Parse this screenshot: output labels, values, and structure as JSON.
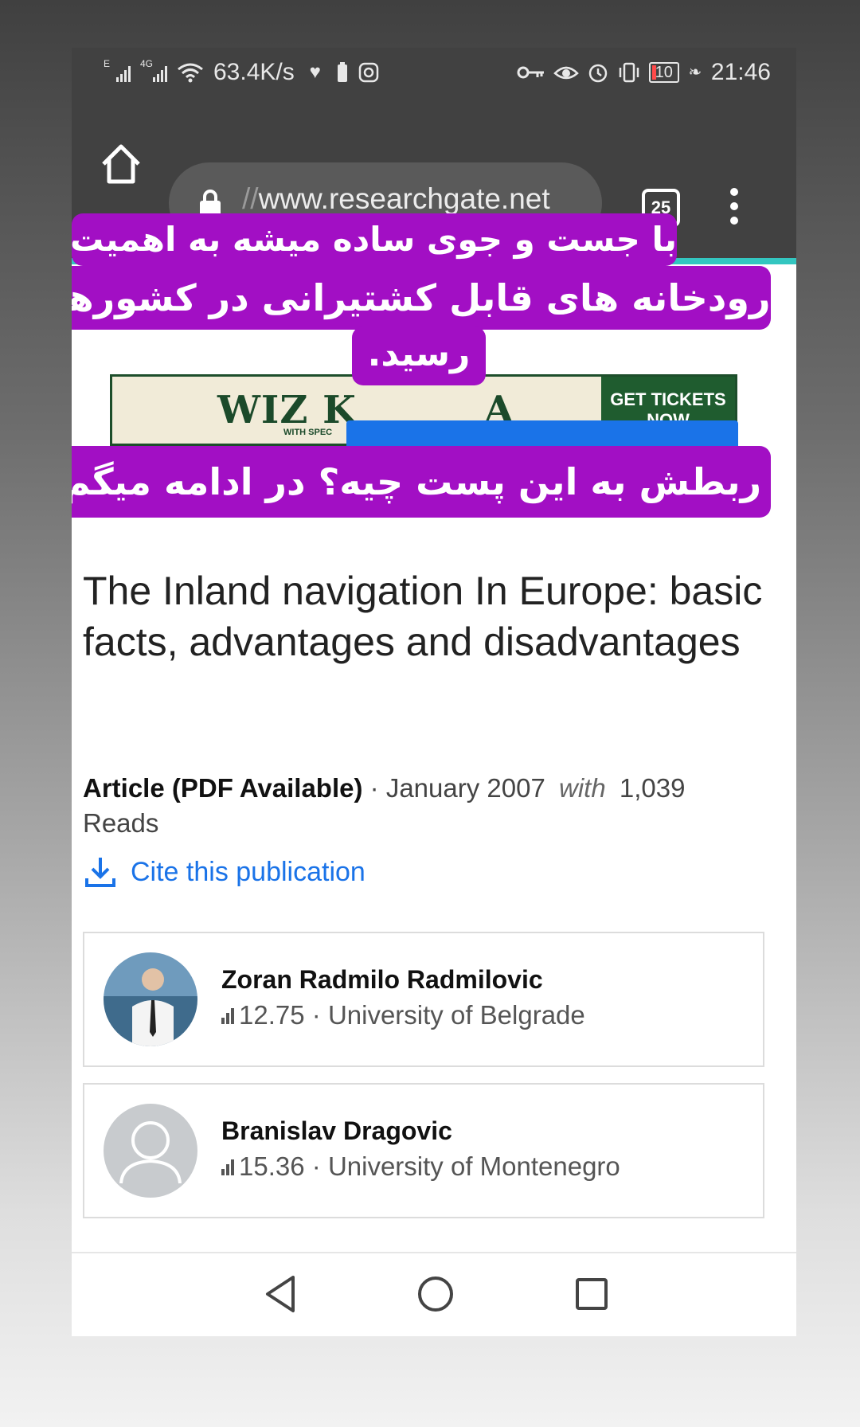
{
  "status_bar": {
    "signal1_label": "E",
    "signal2_label": "4G",
    "network_speed": "63.4K/s",
    "battery_level": "10",
    "time": "21:46",
    "icons": [
      "wifi-icon",
      "heart-icon",
      "battery-saver-icon",
      "instagram-icon",
      "key-icon",
      "eye-icon",
      "alarm-icon",
      "vibrate-icon",
      "leaf-icon"
    ]
  },
  "browser": {
    "url_prefix": "//",
    "url_domain": "www.researchgate.net",
    "tab_count": "25"
  },
  "overlay": {
    "line1": "با جست و جوی ساده میشه به اهمیت",
    "line2": "رودخانه های قابل کشتیرانی در کشورها",
    "line3": "رسید.",
    "line4": "ربطش به این پست چیه؟ در ادامه میگم",
    "color": "#a20fc4"
  },
  "ad": {
    "headline_visible": "WIZ K",
    "headline_tail": "A",
    "sub_visible": "WITH SPEC",
    "cta_line1": "GET TICKETS",
    "cta_line2": "NOW"
  },
  "article": {
    "title": "The Inland navigation In Europe: basic facts, advantages and disadvantages",
    "type": "Article (PDF Available)",
    "separator": "·",
    "date": "January 2007",
    "with_label": "with",
    "reads": "1,039",
    "reads_label": "Reads",
    "cite_label": "Cite this publication"
  },
  "authors": [
    {
      "name": "Zoran Radmilo Radmilovic",
      "score": "12.75",
      "separator": "·",
      "institution": "University of Belgrade",
      "has_photo": true
    },
    {
      "name": "Branislav Dragovic",
      "score": "15.36",
      "separator": "·",
      "institution": "University of Montenegro",
      "has_photo": false
    }
  ],
  "colors": {
    "link_blue": "#1a73e8",
    "status_bar_bg": "#414141",
    "teal_accent": "#33c6c0",
    "ad_green": "#1f5c2f"
  }
}
